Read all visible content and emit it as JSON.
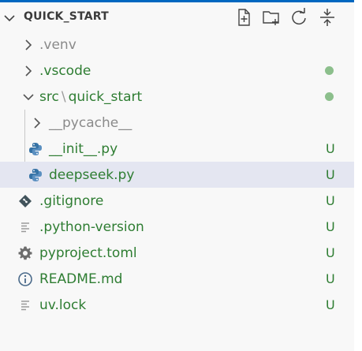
{
  "explorer": {
    "title": "QUICK_START",
    "toolbar": {
      "new_file_icon": "new-file",
      "new_folder_icon": "new-folder",
      "refresh_icon": "refresh",
      "collapse_icon": "collapse-all"
    }
  },
  "colors": {
    "untracked_text": "#2e7d32",
    "ignored_text": "#8a8a8a",
    "modified_dot": "#8cbf8c",
    "selection_bg": "#e4e6f1",
    "focus_border": "#0067c0"
  },
  "tree": [
    {
      "name": ".venv",
      "kind": "folder",
      "expanded": false,
      "style": "ignored"
    },
    {
      "name": ".vscode",
      "kind": "folder",
      "expanded": false,
      "style": "untracked",
      "decoration": "dot"
    },
    {
      "name": "src",
      "name_2": "quick_start",
      "separator": "\\",
      "kind": "folder",
      "expanded": true,
      "style": "untracked",
      "decoration": "dot"
    },
    {
      "name": "__pycache__",
      "kind": "folder",
      "expanded": false,
      "style": "ignored"
    },
    {
      "name": "__init__.py",
      "kind": "python-file",
      "style": "untracked",
      "status": "U"
    },
    {
      "name": "deepseek.py",
      "kind": "python-file",
      "style": "untracked",
      "status": "U",
      "selected": true
    },
    {
      "name": ".gitignore",
      "kind": "git-file",
      "style": "untracked",
      "status": "U"
    },
    {
      "name": ".python-version",
      "kind": "text-file",
      "style": "untracked",
      "status": "U"
    },
    {
      "name": "pyproject.toml",
      "kind": "settings-file",
      "style": "untracked",
      "status": "U"
    },
    {
      "name": "README.md",
      "kind": "info-file",
      "style": "untracked",
      "status": "U"
    },
    {
      "name": "uv.lock",
      "kind": "text-file",
      "style": "untracked",
      "status": "U"
    }
  ]
}
